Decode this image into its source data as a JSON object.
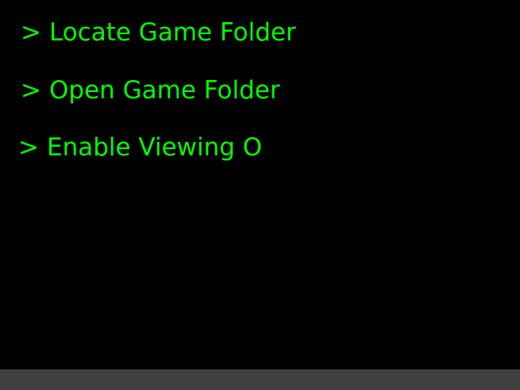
{
  "colors": {
    "background": "#000000",
    "text": "#00ff00",
    "bottom_bar": "#404040"
  },
  "menu": {
    "prompt": ">",
    "items": [
      {
        "label": "Locate Game Folder"
      },
      {
        "label": "Open Game Folder"
      },
      {
        "label": "Enable Viewing O"
      }
    ]
  }
}
